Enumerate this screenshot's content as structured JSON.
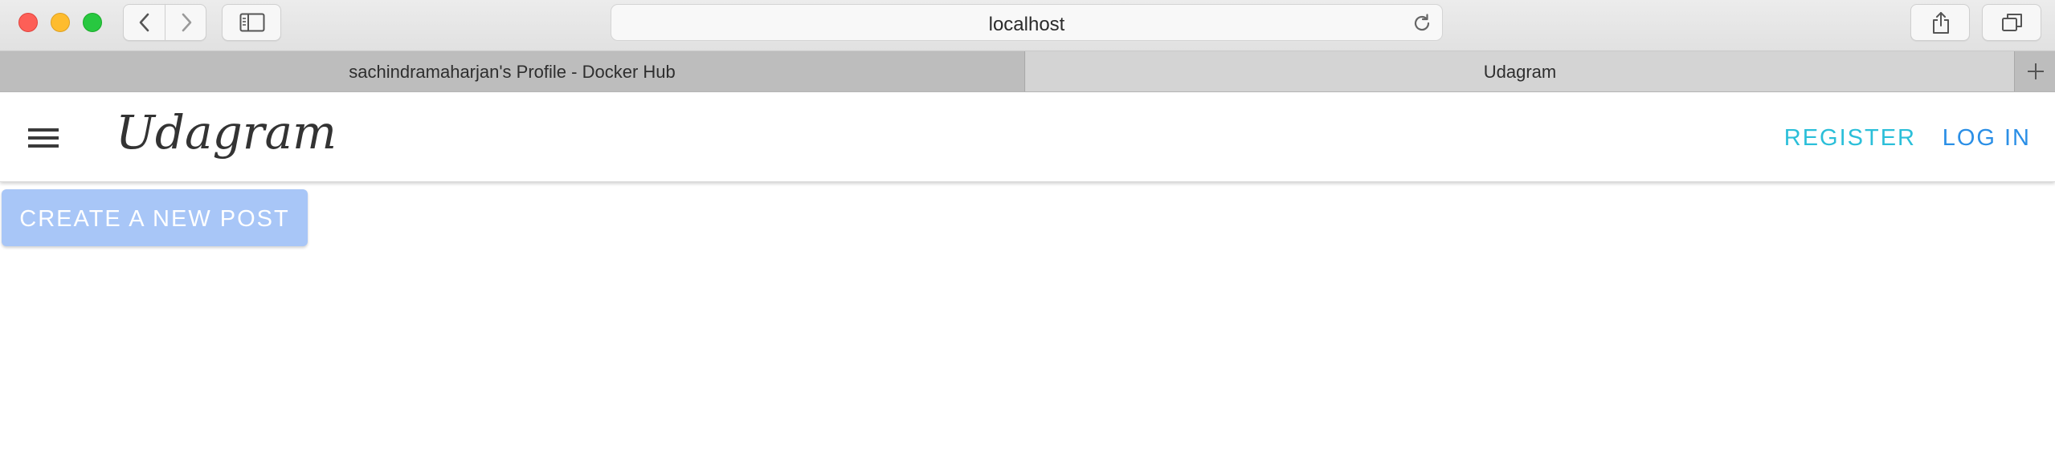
{
  "browser": {
    "url": "localhost",
    "tabs": [
      {
        "label": "sachindramaharjan's Profile - Docker Hub",
        "active": false
      },
      {
        "label": "Udagram",
        "active": true
      }
    ],
    "icons": {
      "back": "chevron-left-icon",
      "forward": "chevron-right-icon",
      "sidebar": "sidebar-icon",
      "reload": "reload-icon",
      "share": "share-icon",
      "tabs_overview": "tabs-overview-icon",
      "new_tab": "plus-icon"
    },
    "traffic_lights": {
      "close": "#fd5f57",
      "minimize": "#febc2e",
      "maximize": "#28c840"
    }
  },
  "app": {
    "brand": "Udagram",
    "menu_icon": "hamburger-menu-icon",
    "nav": {
      "register": "REGISTER",
      "login": "LOG IN"
    },
    "create_post_label": "CREATE A NEW POST",
    "colors": {
      "register": "#2bbfd9",
      "login": "#2b8fe6",
      "create_post_bg": "#a8c6f7",
      "brand_text": "#333333"
    }
  }
}
